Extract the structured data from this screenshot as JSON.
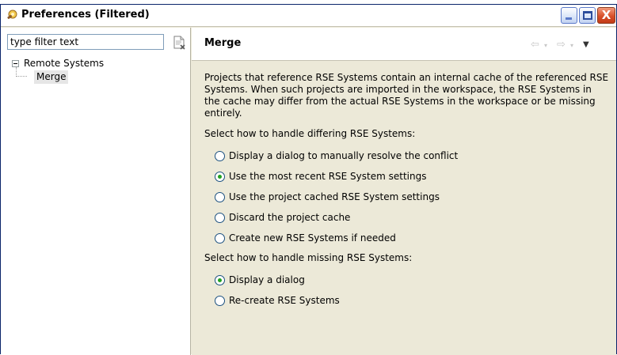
{
  "window": {
    "title": "Preferences (Filtered)",
    "controls": {
      "minimize": "_",
      "maximize": "□",
      "close": "X"
    }
  },
  "colors": {
    "title_bg": "#ffffff",
    "pane_bg": "#ece9d8",
    "radio_checked": "#21a121",
    "close_button": "#d8502a"
  },
  "sidebar": {
    "filter_placeholder": "type filter text",
    "filter_value": "type filter text",
    "clear_icon": "clear-filter-icon",
    "tree": [
      {
        "label": "Remote Systems",
        "expanded": true,
        "children": [
          {
            "label": "Merge",
            "selected": true
          }
        ]
      }
    ]
  },
  "page": {
    "title": "Merge",
    "nav": {
      "back": "⇦",
      "forward": "⇨",
      "dropdown": "▾",
      "menu": "▼"
    },
    "description": "Projects that reference RSE Systems contain an internal cache of the referenced RSE Systems. When such projects are imported in the workspace, the RSE Systems in the cache may differ from the actual RSE Systems in the workspace or be missing entirely.",
    "differing": {
      "label": "Select how to handle differing RSE Systems:",
      "options": [
        {
          "label": "Display a dialog to manually resolve the conflict",
          "checked": false
        },
        {
          "label": "Use the most recent RSE System settings",
          "checked": true
        },
        {
          "label": "Use the project cached RSE System settings",
          "checked": false
        },
        {
          "label": "Discard the project cache",
          "checked": false
        },
        {
          "label": "Create new RSE Systems if needed",
          "checked": false
        }
      ]
    },
    "missing": {
      "label": "Select how to handle missing RSE Systems:",
      "options": [
        {
          "label": "Display a dialog",
          "checked": true
        },
        {
          "label": "Re-create RSE Systems",
          "checked": false
        }
      ]
    }
  }
}
